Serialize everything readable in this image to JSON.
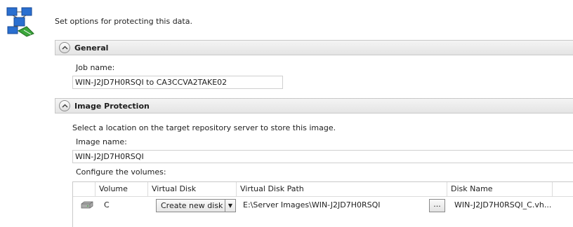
{
  "page": {
    "subtitle": "Set options for protecting this data."
  },
  "general": {
    "title": "General",
    "job_name_label": "Job name:",
    "job_name_value": "WIN-J2JD7H0RSQI to CA3CCVA2TAKE02"
  },
  "image_protection": {
    "title": "Image Protection",
    "description": "Select a location on the target repository server to store this image.",
    "image_name_label": "Image name:",
    "image_name_value": "WIN-J2JD7H0RSQI",
    "volumes_label": "Configure the volumes:",
    "table": {
      "columns": [
        "Volume",
        "Virtual Disk",
        "Virtual Disk Path",
        "Disk Name"
      ],
      "rows": [
        {
          "volume": "C",
          "virtual_disk": "Create new disk",
          "virtual_disk_path": "E:\\Server Images\\WIN-J2JD7H0RSQI",
          "browse": "...",
          "disk_name": "WIN-J2JD7H0RSQI_C.vh..."
        }
      ]
    }
  },
  "icons": {
    "logo": "server-protection-icon",
    "section_toggle": "chevron-up-icon",
    "drive": "drive-icon",
    "dropdown": "dropdown-arrow-icon"
  },
  "colors": {
    "section_header_bg": "#e9e9e9",
    "logo_blue": "#2a6fd0",
    "logo_green": "#3aa63a"
  }
}
